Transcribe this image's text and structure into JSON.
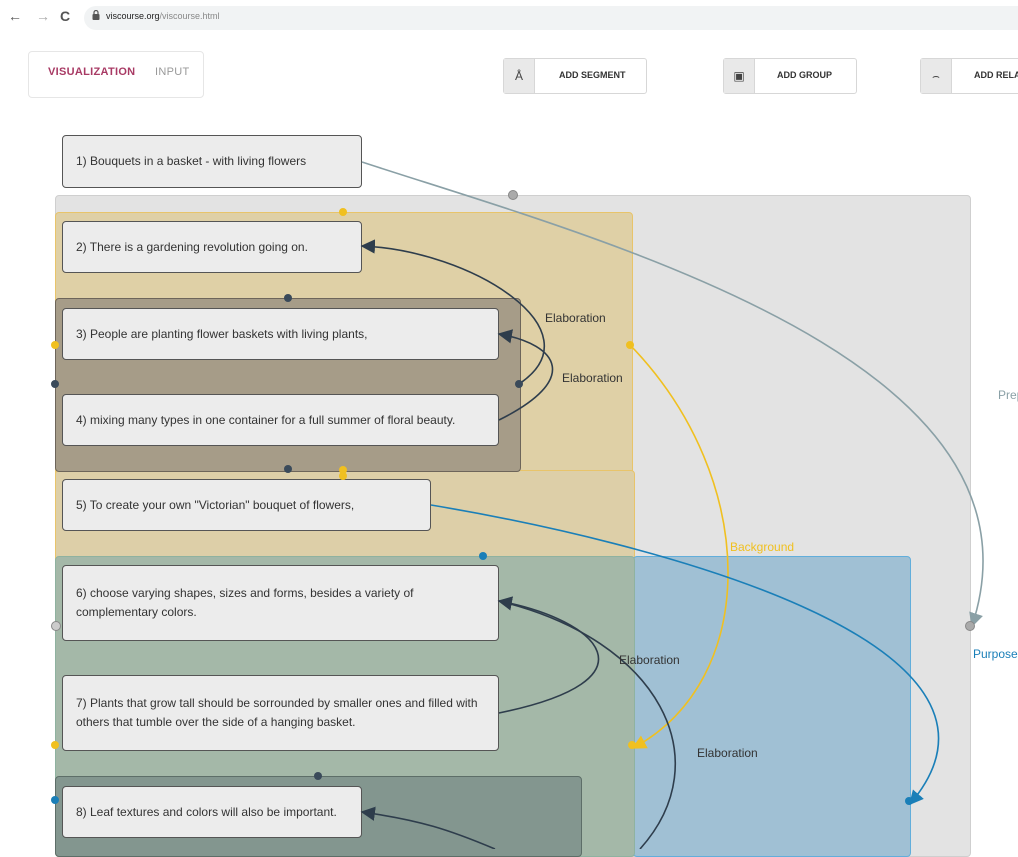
{
  "browser": {
    "url_domain": "viscourse.org",
    "url_path": "/viscourse.html",
    "back": "←",
    "forward": "→",
    "reload": "C"
  },
  "header": {
    "tabs": [
      {
        "label": "VISUALIZATION",
        "active": true
      },
      {
        "label": "INPUT",
        "active": false
      }
    ],
    "tools": [
      {
        "label": "ADD SEGMENT",
        "icon": "segment-icon"
      },
      {
        "label": "ADD GROUP",
        "icon": "group-icon"
      },
      {
        "label": "ADD RELAT",
        "icon": "relation-icon"
      }
    ]
  },
  "segments": [
    "1) Bouquets in a basket - with living flowers",
    "2) There is a gardening revolution going on.",
    "3) People are planting flower baskets with living plants,",
    "4) mixing many types in one container for a full summer of floral beauty.",
    "5) To create your own \"Victorian\" bouquet of flowers,",
    "6) choose varying shapes, sizes and forms, besides a variety of complementary colors.",
    "7) Plants that grow tall should be sorrounded by smaller ones and filled with others that tumble over the side of a hanging basket.",
    "8) Leaf textures and colors will also be important."
  ],
  "relations": [
    {
      "label": "Elaboration",
      "color": "#3a4a5a"
    },
    {
      "label": "Elaboration",
      "color": "#3a4a5a"
    },
    {
      "label": "Background",
      "color": "#f0c020"
    },
    {
      "label": "Elaboration",
      "color": "#3a4a5a"
    },
    {
      "label": "Elaboration",
      "color": "#3a4a5a"
    },
    {
      "label": "Purpose",
      "color": "#1a7fb8"
    },
    {
      "label": "Prep",
      "color": "#8aa0a6"
    }
  ],
  "colors": {
    "accent": "#a83a64",
    "outer_group": "#e3e3e3",
    "background_group": "#dfd0a6",
    "elaboration_group": "#a69c88",
    "purpose_group": "#a0c0d4",
    "green_group": "#a4b8a8",
    "dark_group": "#83968f"
  }
}
